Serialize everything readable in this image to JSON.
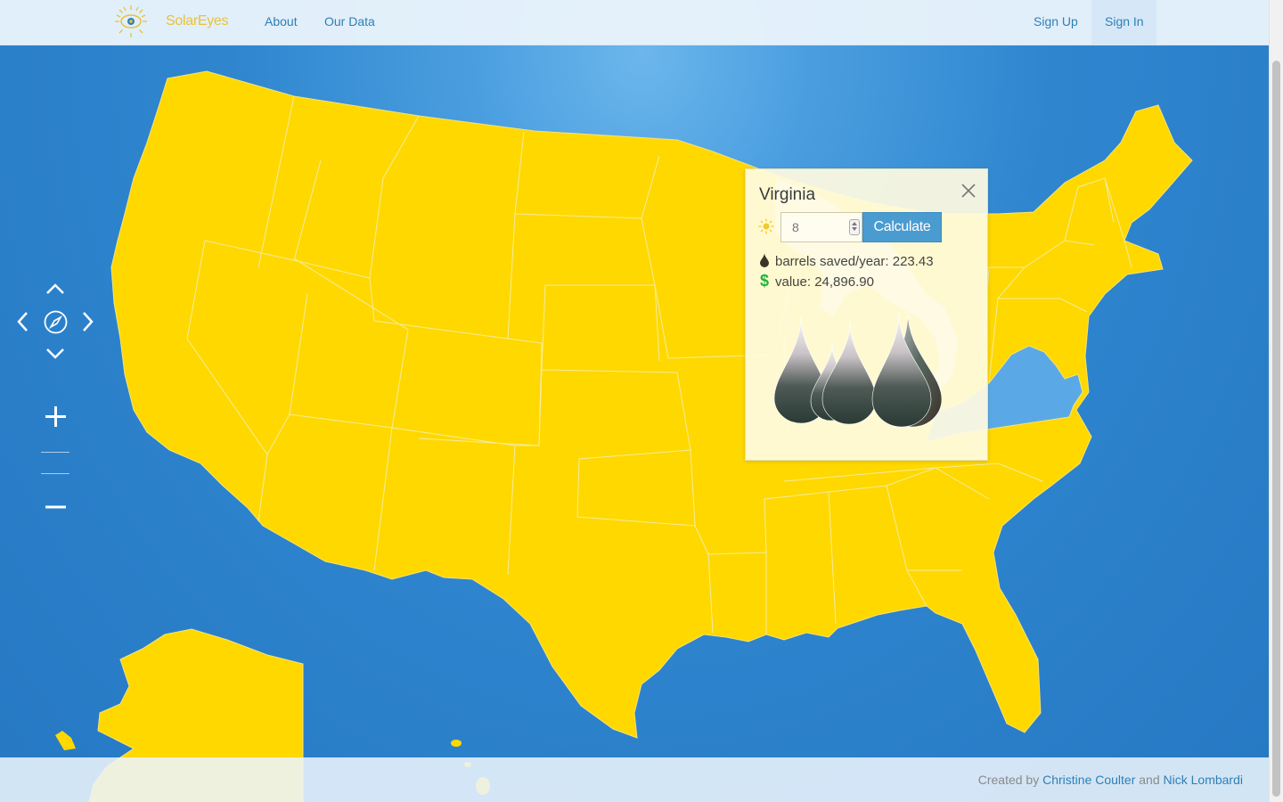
{
  "navbar": {
    "brand": "SolarEyes",
    "links": [
      "About",
      "Our Data"
    ],
    "sign_up": "Sign Up",
    "sign_in": "Sign In",
    "active": "Sign In"
  },
  "map": {
    "highlighted_state": "Virginia",
    "colors": {
      "ocean": "#2a7fc8",
      "state_fill": "#ffd800",
      "highlight_fill": "#5aa9e6",
      "border": "#f5e9a0"
    },
    "controls": {
      "pan_up": "chevron-up-icon",
      "pan_left": "chevron-left-icon",
      "compass": "compass-icon",
      "pan_right": "chevron-right-icon",
      "pan_down": "chevron-down-icon",
      "zoom_in": "plus-icon",
      "zoom_out": "minus-icon"
    }
  },
  "popup": {
    "title": "Virginia",
    "hours_value": "8",
    "calculate_label": "Calculate",
    "barrels_label": "barrels saved/year: 223.43",
    "value_label": "value: 24,896.90",
    "barrels_saved": 223.43,
    "value": 24896.9
  },
  "footer": {
    "prefix": "Created by ",
    "author1": "Christine Coulter",
    "joiner": " and ",
    "author2": "Nick Lombardi"
  }
}
